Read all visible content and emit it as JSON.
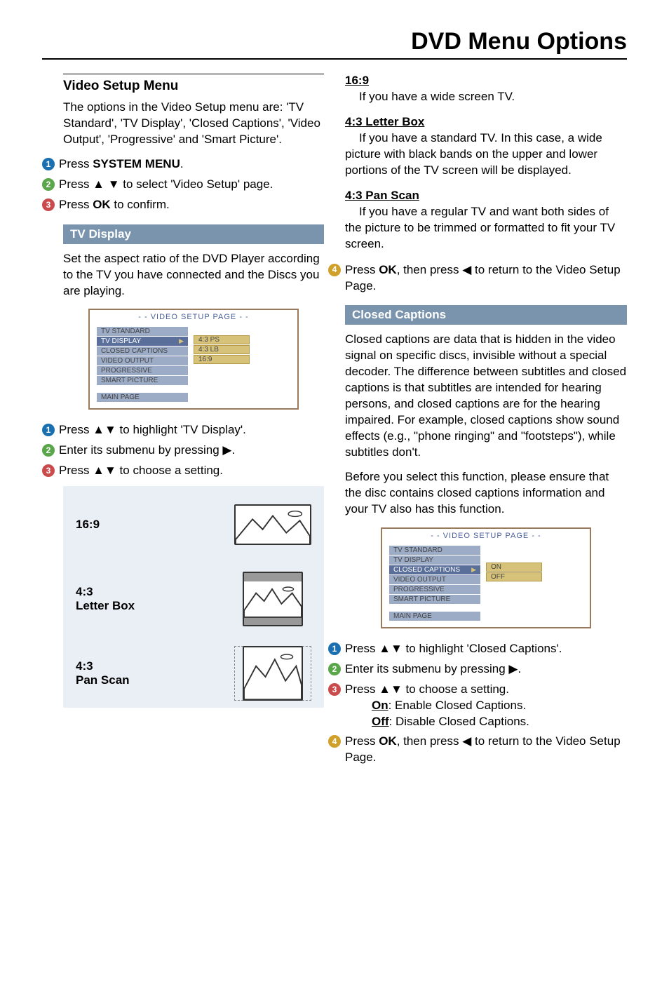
{
  "page_title": "DVD Menu Options",
  "left": {
    "video_setup_title": "Video Setup Menu",
    "video_setup_body": "The options in the Video Setup menu are: 'TV Standard', 'TV Display', 'Closed Captions', 'Video Output', 'Progressive' and 'Smart Picture'.",
    "step1_a": "Press ",
    "step1_b": "SYSTEM MENU",
    "step1_c": ".",
    "step2": "Press ▲ ▼ to select 'Video Setup' page.",
    "step3_a": "Press ",
    "step3_b": "OK",
    "step3_c": " to confirm.",
    "tv_display_bar": "TV Display",
    "tv_display_body": "Set the aspect ratio of the DVD Player according to the TV you have connected and the Discs you are playing.",
    "screenshot1": {
      "title": "- - VIDEO SETUP PAGE - -",
      "items": [
        "TV STANDARD",
        "TV DISPLAY",
        "CLOSED CAPTIONS",
        "VIDEO OUTPUT",
        "PROGRESSIVE",
        "SMART PICTURE"
      ],
      "selected_index": 1,
      "options": [
        "4:3 PS",
        "4:3 LB",
        "16:9"
      ],
      "main_page": "MAIN PAGE"
    },
    "tv_step1": "Press ▲▼ to highlight 'TV Display'.",
    "tv_step2": "Enter its submenu by pressing ▶.",
    "tv_step3": "Press ▲▼ to choose a setting.",
    "aspect": {
      "r1": "16:9",
      "r2a": "4:3",
      "r2b": "Letter Box",
      "r3a": "4:3",
      "r3b": "Pan Scan"
    }
  },
  "right": {
    "h1": "16:9",
    "h1_body": "If you have a wide screen TV.",
    "h2": "4:3 Letter Box",
    "h2_body": "If you have a standard TV. In this case, a wide picture with black bands on the upper and lower portions of the TV screen will be displayed.",
    "h3": "4:3 Pan Scan",
    "h3_body": "If you have a regular TV and want both sides of the picture to be trimmed or formatted to fit your TV screen.",
    "step4_a": "Press ",
    "step4_b": "OK",
    "step4_c": ", then press ◀ to return to the Video Setup Page.",
    "cc_bar": "Closed Captions",
    "cc_body1": "Closed captions are data that is hidden in the video signal on specific discs, invisible without a special decoder. The difference between subtitles and closed captions is that subtitles are intended for hearing persons, and closed captions are for the hearing impaired. For example, closed captions show sound effects (e.g., \"phone ringing\" and \"footsteps\"), while subtitles don't.",
    "cc_body2": "Before you select this function, please ensure that the disc contains closed captions information and your TV also has this function.",
    "screenshot2": {
      "title": "- - VIDEO SETUP PAGE - -",
      "items": [
        "TV STANDARD",
        "TV DISPLAY",
        "CLOSED CAPTIONS",
        "VIDEO OUTPUT",
        "PROGRESSIVE",
        "SMART PICTURE"
      ],
      "selected_index": 2,
      "options": [
        "ON",
        "OFF"
      ],
      "main_page": "MAIN PAGE"
    },
    "cc_step1": "Press ▲▼ to highlight 'Closed Captions'.",
    "cc_step2": "Enter its submenu by pressing ▶.",
    "cc_step3_a": "Press ▲▼ to choose a setting.",
    "cc_on_label": "On",
    "cc_on_desc": ": Enable Closed Captions.",
    "cc_off_label": "Off",
    "cc_off_desc": ": Disable Closed Captions.",
    "cc_step4_a": "Press ",
    "cc_step4_b": "OK",
    "cc_step4_c": ", then press ◀ to return to the Video Setup Page."
  }
}
